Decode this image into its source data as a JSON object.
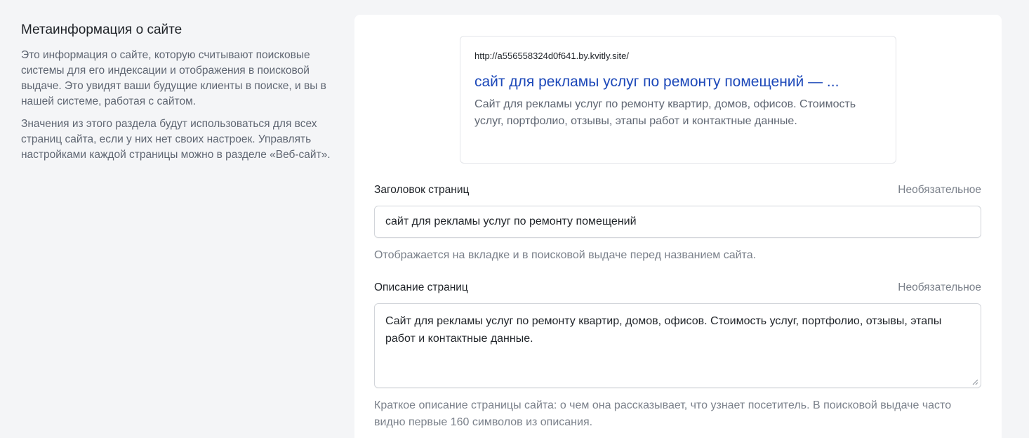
{
  "section": {
    "title": "Метаинформация о сайте",
    "paragraph1": "Это информация о сайте, которую считывают поисковые системы для его индексации и отображения в поисковой выдаче. Это увидят ваши будущие клиенты в поиске, и вы в нашей системе, работая с сайтом.",
    "paragraph2": "Значения из этого раздела будут использоваться для всех страниц сайта, если у них нет своих настроек. Управлять настройками каждой страницы можно в разделе «Веб-сайт»."
  },
  "preview": {
    "url": "http://a556558324d0f641.by.kvitly.site/",
    "title": "сайт для рекламы услуг по ремонту помещений — ...",
    "description": "Сайт для рекламы услуг по ремонту квартир, домов, офисов. Стоимость услуг, портфолио, отзывы, этапы работ и контактные данные."
  },
  "page_title_field": {
    "label": "Заголовок страниц",
    "optional": "Необязательное",
    "value": "сайт для рекламы услуг по ремонту помещений",
    "hint": "Отображается на вкладке и в поисковой выдаче перед названием сайта."
  },
  "page_description_field": {
    "label": "Описание страниц",
    "optional": "Необязательное",
    "value": "Сайт для рекламы услуг по ремонту квартир, домов, офисов. Стоимость услуг, портфолио, отзывы, этапы работ и контактные данные.",
    "hint": "Краткое описание страницы сайта: о чем она рассказывает, что узнает посетитель. В поисковой выдаче часто видно первые 160 символов из описания."
  },
  "colors": {
    "background": "#f4f5f7",
    "card": "#ffffff",
    "link_blue": "#1c48b9",
    "muted_text": "#7a808a"
  }
}
